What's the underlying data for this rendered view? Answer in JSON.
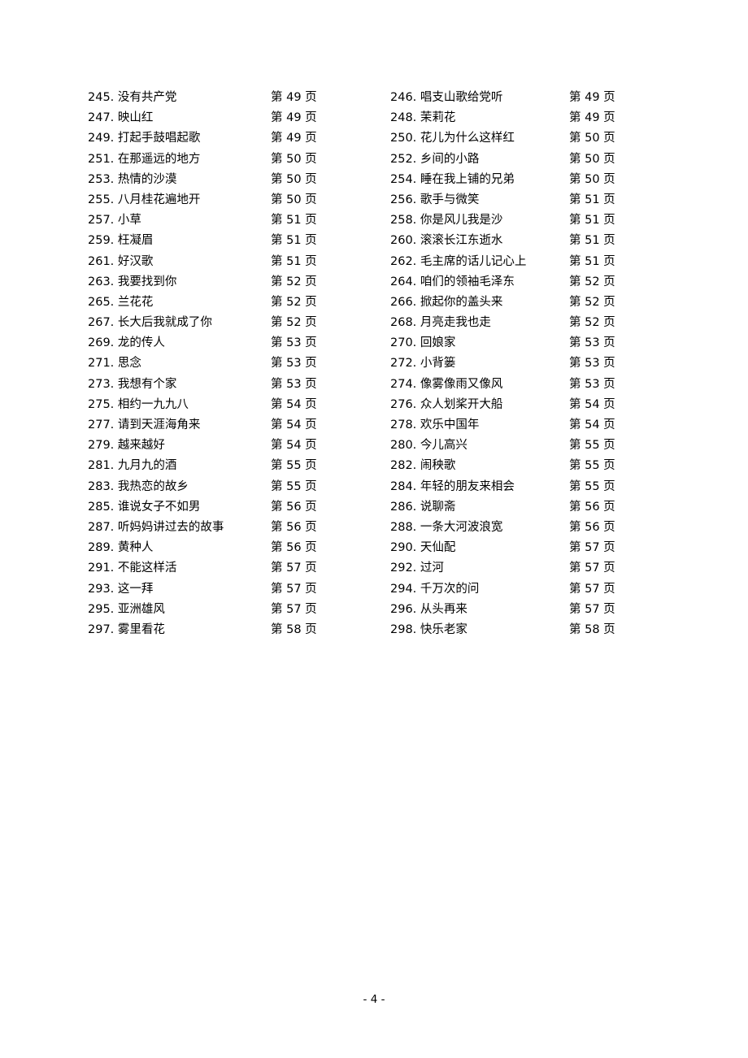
{
  "document": {
    "page_number_label": "- 4 -"
  },
  "toc": {
    "rows": [
      {
        "left": {
          "title": "245. 没有共产党",
          "page": "第 49 页"
        },
        "right": {
          "title": "246. 唱支山歌给党听",
          "page": "第 49 页"
        }
      },
      {
        "left": {
          "title": "247. 映山红",
          "page": "第 49 页"
        },
        "right": {
          "title": "248. 茉莉花",
          "page": "第 49 页"
        }
      },
      {
        "left": {
          "title": "249. 打起手鼓唱起歌",
          "page": "第 49 页"
        },
        "right": {
          "title": "250. 花儿为什么这样红",
          "page": "第 50 页"
        }
      },
      {
        "left": {
          "title": "251. 在那遥远的地方",
          "page": "第 50 页"
        },
        "right": {
          "title": "252. 乡间的小路",
          "page": "第 50 页"
        }
      },
      {
        "left": {
          "title": "253. 热情的沙漠",
          "page": "第 50 页"
        },
        "right": {
          "title": "254. 睡在我上铺的兄弟",
          "page": "第 50 页"
        }
      },
      {
        "left": {
          "title": "255. 八月桂花遍地开",
          "page": "第 50 页"
        },
        "right": {
          "title": "256. 歌手与微笑",
          "page": "第 51 页"
        }
      },
      {
        "left": {
          "title": "257. 小草",
          "page": "第 51 页"
        },
        "right": {
          "title": "258. 你是风儿我是沙",
          "page": "第 51 页"
        }
      },
      {
        "left": {
          "title": "259. 枉凝眉",
          "page": "第 51 页"
        },
        "right": {
          "title": "260. 滚滚长江东逝水",
          "page": "第 51 页"
        }
      },
      {
        "left": {
          "title": "261. 好汉歌",
          "page": "第 51 页"
        },
        "right": {
          "title": "262. 毛主席的话儿记心上",
          "page": "第 51 页"
        }
      },
      {
        "left": {
          "title": "263. 我要找到你",
          "page": "第 52 页"
        },
        "right": {
          "title": "264. 咱们的领袖毛泽东",
          "page": "第 52 页"
        }
      },
      {
        "left": {
          "title": "265. 兰花花",
          "page": "第 52 页"
        },
        "right": {
          "title": "266. 掀起你的盖头来",
          "page": "第 52 页"
        }
      },
      {
        "left": {
          "title": "267. 长大后我就成了你",
          "page": "第 52 页"
        },
        "right": {
          "title": "268. 月亮走我也走",
          "page": "第 52 页"
        }
      },
      {
        "left": {
          "title": "269. 龙的传人",
          "page": "第 53 页"
        },
        "right": {
          "title": "270. 回娘家",
          "page": "第 53 页"
        }
      },
      {
        "left": {
          "title": "271. 思念",
          "page": "第 53 页"
        },
        "right": {
          "title": "272. 小背篓",
          "page": "第 53 页"
        }
      },
      {
        "left": {
          "title": "273. 我想有个家",
          "page": "第 53 页"
        },
        "right": {
          "title": "274. 像雾像雨又像风",
          "page": "第 53 页"
        }
      },
      {
        "left": {
          "title": "275. 相约一九九八",
          "page": "第 54 页"
        },
        "right": {
          "title": "276. 众人划桨开大船",
          "page": "第 54 页"
        }
      },
      {
        "left": {
          "title": "277. 请到天涯海角来",
          "page": "第 54 页"
        },
        "right": {
          "title": "278. 欢乐中国年",
          "page": "第 54 页"
        }
      },
      {
        "left": {
          "title": "279. 越来越好",
          "page": "第 54 页"
        },
        "right": {
          "title": "280. 今儿高兴",
          "page": "第 55 页"
        }
      },
      {
        "left": {
          "title": "281. 九月九的酒",
          "page": "第 55 页"
        },
        "right": {
          "title": "282. 闹秧歌",
          "page": "第 55 页"
        }
      },
      {
        "left": {
          "title": "283. 我热恋的故乡",
          "page": "第 55 页"
        },
        "right": {
          "title": "284. 年轻的朋友来相会",
          "page": "第 55 页"
        }
      },
      {
        "left": {
          "title": "285. 谁说女子不如男",
          "page": "第 56 页"
        },
        "right": {
          "title": "286. 说聊斋",
          "page": "第 56 页"
        }
      },
      {
        "left": {
          "title": "287. 听妈妈讲过去的故事",
          "page": "第 56 页"
        },
        "right": {
          "title": "288. 一条大河波浪宽",
          "page": "第 56 页"
        }
      },
      {
        "left": {
          "title": "289. 黄种人",
          "page": "第 56 页"
        },
        "right": {
          "title": "290. 天仙配",
          "page": "第 57 页"
        }
      },
      {
        "left": {
          "title": "291. 不能这样活",
          "page": "第 57 页"
        },
        "right": {
          "title": "292. 过河",
          "page": "第 57 页"
        }
      },
      {
        "left": {
          "title": "293. 这一拜",
          "page": "第 57 页"
        },
        "right": {
          "title": "294. 千万次的问",
          "page": "第 57 页"
        }
      },
      {
        "left": {
          "title": "295. 亚洲雄风",
          "page": "第 57 页"
        },
        "right": {
          "title": "296. 从头再来",
          "page": "第 57 页"
        }
      },
      {
        "left": {
          "title": "297. 雾里看花",
          "page": "第 58 页"
        },
        "right": {
          "title": "298. 快乐老家",
          "page": "第 58 页"
        }
      }
    ]
  }
}
